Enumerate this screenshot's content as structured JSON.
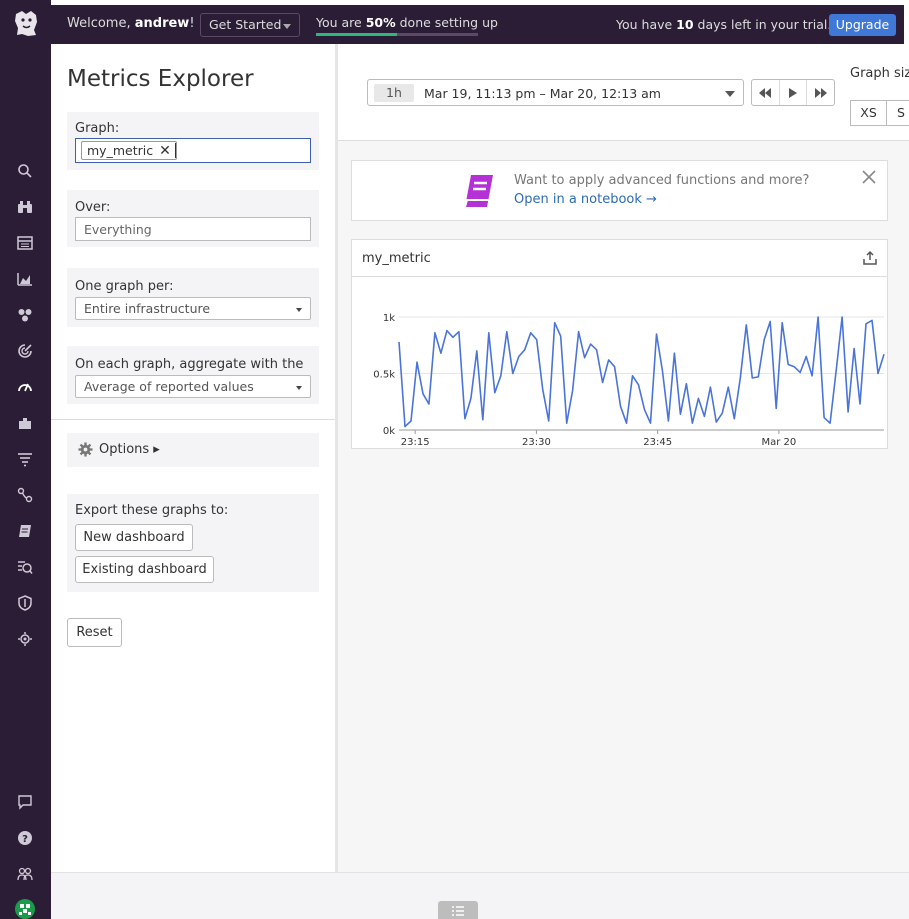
{
  "topbar": {
    "welcome_prefix": "Welcome, ",
    "username": "andrew",
    "welcome_suffix": "!",
    "get_started": "Get Started",
    "progress_prefix": "You are ",
    "progress_percent_text": "50%",
    "progress_suffix": " done setting up",
    "progress_fraction": 0.5,
    "trial_prefix": "You have ",
    "trial_days": "10",
    "trial_suffix": " days left in your trial.",
    "upgrade": "Upgrade"
  },
  "panel": {
    "title": "Metrics Explorer",
    "graph_label": "Graph:",
    "graph_metric": "my_metric",
    "over_label": "Over:",
    "over_placeholder": "Everything",
    "one_graph_per_label": "One graph per:",
    "one_graph_per_value": "Entire infrastructure",
    "aggregate_label": "On each graph, aggregate with the",
    "aggregate_value": "Average of reported values",
    "options_label": "Options ▸",
    "export_label": "Export these graphs to:",
    "new_dashboard": "New dashboard",
    "existing_dashboard": "Existing dashboard",
    "reset": "Reset"
  },
  "toolbar": {
    "time_pill": "1h",
    "time_range": "Mar 19, 11:13 pm – Mar 20, 12:13 am",
    "graph_size_label": "Graph size",
    "sizes": [
      "XS",
      "S"
    ]
  },
  "banner": {
    "text": "Want to apply advanced functions and more?",
    "link": "Open in a notebook →"
  },
  "colors": {
    "nav_bg": "#2b1d35",
    "accent_blue": "#3f78d6",
    "progress_green": "#2eb67d",
    "series_line": "#4a74d8",
    "notebook_icon": "#b431d6"
  },
  "icons": {
    "nav": [
      "search-icon",
      "binoculars-icon",
      "dashboard-icon",
      "infrastructure-icon",
      "monitors-icon",
      "metrics-icon",
      "integrations-icon",
      "logs-icon",
      "apm-icon",
      "notebooks-icon",
      "synthetics-icon",
      "security-icon",
      "rum-icon",
      "chat-icon",
      "help-icon",
      "team-icon",
      "user-avatar-icon"
    ]
  },
  "chart_data": {
    "type": "line",
    "title": "my_metric",
    "xlabel": "",
    "ylabel": "",
    "ylim": [
      0,
      1000
    ],
    "y_ticks": [
      "1k",
      "0.5k",
      "0k"
    ],
    "x_ticks": [
      "23:15",
      "23:30",
      "23:45",
      "Mar 20"
    ],
    "x_range_minutes": [
      0,
      60
    ],
    "grid": true,
    "series": [
      {
        "values": [
          780,
          30,
          80,
          600,
          320,
          230,
          860,
          680,
          880,
          820,
          870,
          100,
          280,
          700,
          90,
          860,
          330,
          480,
          870,
          500,
          650,
          710,
          860,
          800,
          360,
          80,
          950,
          830,
          60,
          350,
          870,
          640,
          760,
          710,
          420,
          620,
          560,
          210,
          60,
          480,
          400,
          180,
          60,
          850,
          520,
          80,
          680,
          140,
          410,
          60,
          280,
          120,
          380,
          70,
          150,
          380,
          100,
          460,
          930,
          460,
          470,
          800,
          960,
          190,
          950,
          580,
          560,
          510,
          650,
          480,
          1000,
          110,
          60,
          520,
          1000,
          160,
          720,
          230,
          940,
          970,
          500,
          670
        ]
      }
    ]
  }
}
